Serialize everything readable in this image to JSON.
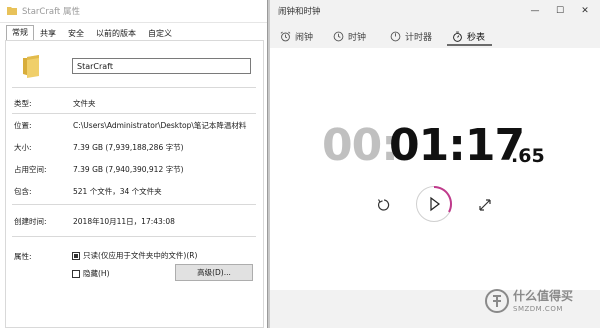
{
  "properties": {
    "title": "StarCraft 属性",
    "tabs": [
      "常规",
      "共享",
      "安全",
      "以前的版本",
      "自定义"
    ],
    "name_value": "StarCraft",
    "rows": [
      {
        "label": "类型:",
        "value": "文件夹"
      },
      {
        "label": "位置:",
        "value": "C:\\Users\\Administrator\\Desktop\\笔记本降温材料"
      },
      {
        "label": "大小:",
        "value": "7.39 GB (7,939,188,286 字节)"
      },
      {
        "label": "占用空间:",
        "value": "7.39 GB (7,940,390,912 字节)"
      },
      {
        "label": "包含:",
        "value": "521 个文件，34 个文件夹"
      },
      {
        "label": "创建时间:",
        "value": "2018年10月11日，17:43:08"
      }
    ],
    "attributes_label": "属性:",
    "readonly_label": "只读(仅应用于文件夹中的文件)(R)",
    "hidden_label": "隐藏(H)",
    "advanced_button": "高级(D)..."
  },
  "clock": {
    "title": "闹钟和时钟",
    "nav": [
      "闹钟",
      "时钟",
      "计时器",
      "秒表"
    ],
    "stopwatch": {
      "dim": "00:",
      "main": "01:17",
      "ms": ".65"
    }
  },
  "watermark": {
    "line1": "什么值得买",
    "line2": "SMZDM.COM"
  },
  "colors": {
    "accent": "#c03a8c",
    "folder": "#e8c25a"
  }
}
